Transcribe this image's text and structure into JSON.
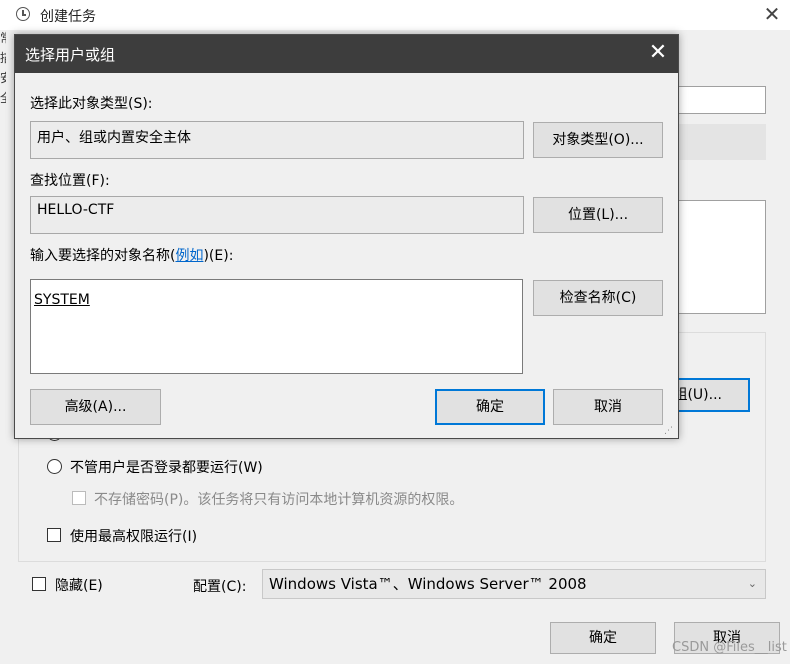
{
  "background_window": {
    "title": "创建任务",
    "left_edge_chars": [
      "常",
      "描",
      "安",
      "全"
    ],
    "partial_user_button": "组(U)...",
    "radio_partial_label": "",
    "radio_always_run": "不管用户是否登录都要运行(W)",
    "checkbox_no_store_password": "不存储密码(P)。该任务将只有访问本地计算机资源的权限。",
    "checkbox_highest_privilege": "使用最高权限运行(I)",
    "checkbox_hidden": "隐藏(E)",
    "config_label": "配置(C):",
    "config_value": "Windows Vista™、Windows Server™ 2008",
    "ok_button": "确定",
    "cancel_button": "取消"
  },
  "dialog": {
    "title": "选择用户或组",
    "object_type_label": "选择此对象类型(S):",
    "object_type_value": "用户、组或内置安全主体",
    "object_type_button": "对象类型(O)...",
    "location_label": "查找位置(F):",
    "location_value": "HELLO-CTF",
    "location_button": "位置(L)...",
    "names_label_prefix": "输入要选择的对象名称(",
    "names_label_link": "例如",
    "names_label_suffix": ")(E):",
    "names_value": "SYSTEM",
    "check_names_button": "检查名称(C)",
    "advanced_button": "高级(A)...",
    "ok_button": "确定",
    "cancel_button": "取消"
  },
  "watermark": "CSDN @Files__list",
  "colors": {
    "dialog_titlebar": "#3d3d3d",
    "accent": "#0078d7",
    "link": "#0066cc"
  }
}
